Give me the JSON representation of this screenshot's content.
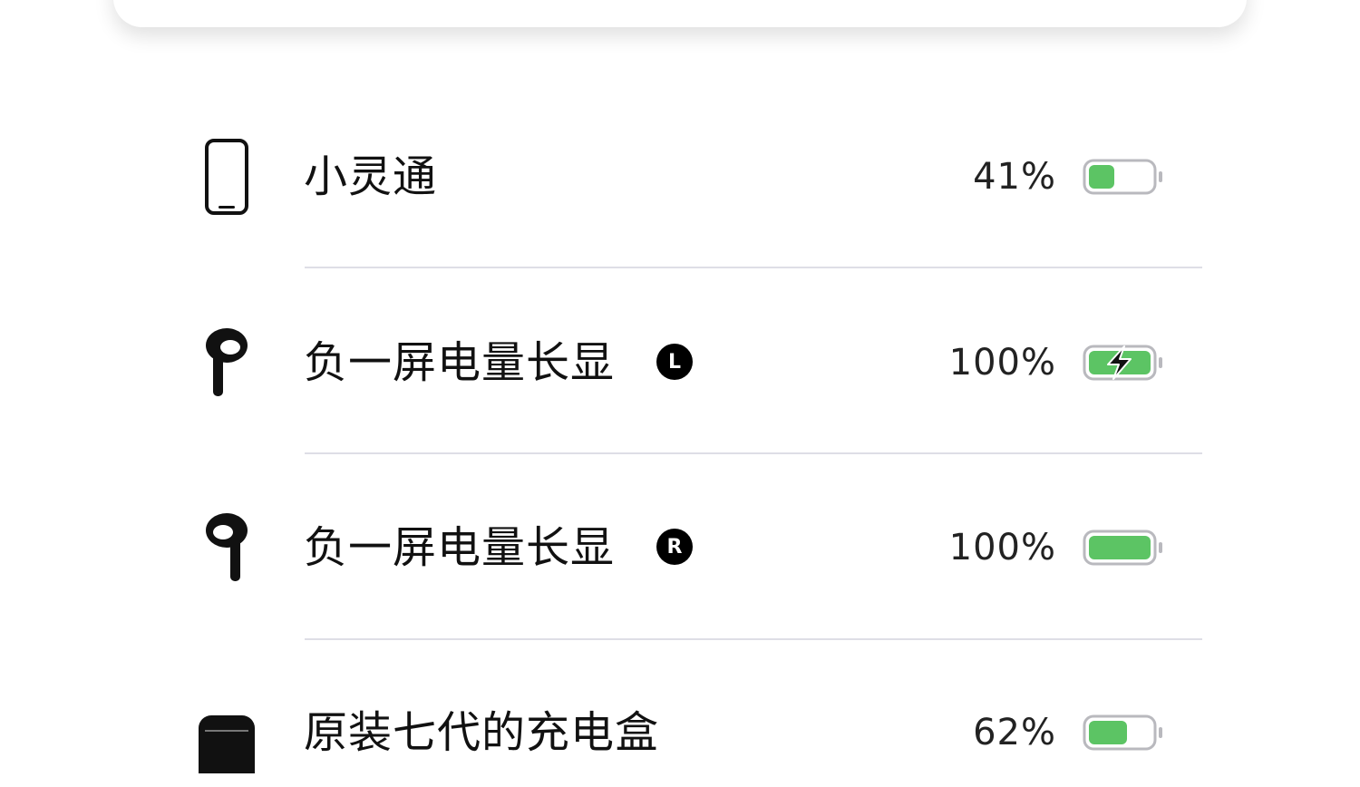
{
  "devices": [
    {
      "name": "小灵通",
      "side": "",
      "percent_text": "41%",
      "level": 0.41,
      "charging": false,
      "icon": "iphone-icon"
    },
    {
      "name": "负一屏电量长显",
      "side": "L",
      "percent_text": "100%",
      "level": 1.0,
      "charging": true,
      "icon": "airpod-left-icon"
    },
    {
      "name": "负一屏电量长显",
      "side": "R",
      "percent_text": "100%",
      "level": 1.0,
      "charging": false,
      "icon": "airpod-right-icon"
    },
    {
      "name": "原装七代的充电盒",
      "side": "",
      "percent_text": "62%",
      "level": 0.62,
      "charging": false,
      "icon": "airpods-case-icon"
    }
  ],
  "colors": {
    "battery_green": "#5cc464",
    "text": "#111111",
    "divider": "#dedee6"
  }
}
